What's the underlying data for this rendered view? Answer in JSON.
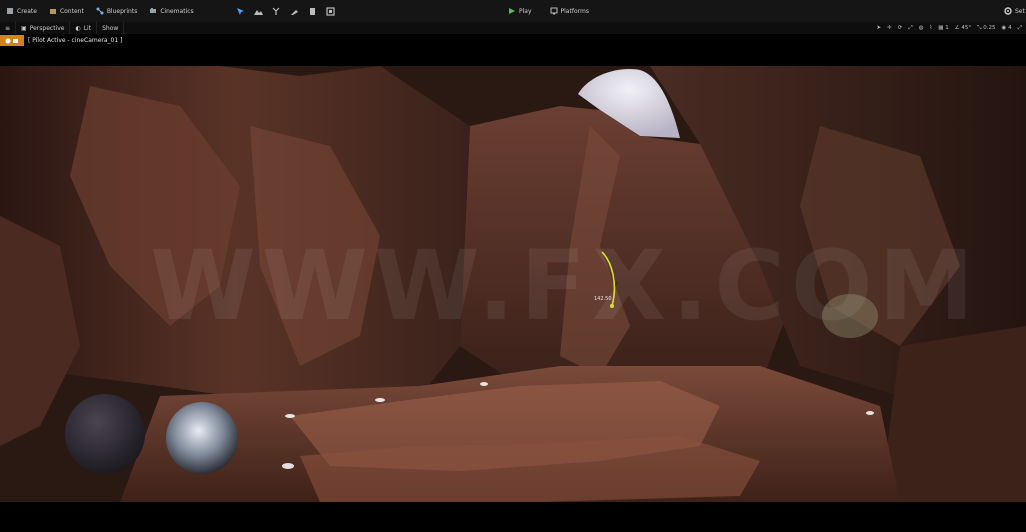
{
  "toolbar": {
    "create": "Create",
    "content": "Content",
    "blueprints": "Blueprints",
    "cinematics": "Cinematics",
    "play": "Play",
    "platforms": "Platforms",
    "settings": "Set"
  },
  "viewport_header": {
    "perspective": "Perspective",
    "lit": "Lit",
    "show": "Show",
    "right": {
      "snap_count": "1",
      "angle": "45°",
      "scale": "0.25",
      "camera_speed": "4"
    }
  },
  "pilot": {
    "label": "[ Pilot Active - cineCamera_01 ]"
  },
  "scene": {
    "readout": "142.50",
    "watermark": "WWW.FX.COM"
  },
  "colors": {
    "accent_orange": "#d5821a",
    "toolbar_bg": "#151515",
    "gizmo_yellow": "#d9dd20"
  }
}
